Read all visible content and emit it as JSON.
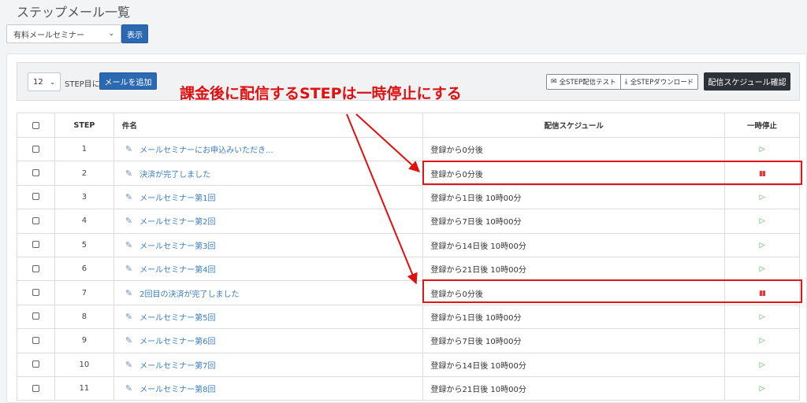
{
  "page": {
    "title": "ステップメール一覧"
  },
  "selector": {
    "value": "有料メールセミナー",
    "show_label": "表示"
  },
  "toolbar": {
    "step_value": "12",
    "step_unit": "STEP目に",
    "add_mail_label": "メールを追加",
    "all_test_label": "全STEP配信テスト",
    "all_download_label": "全STEPダウンロード",
    "schedule_check_label": "配信スケジュール確認"
  },
  "table": {
    "headers": {
      "step": "STEP",
      "subject": "件名",
      "schedule": "配信スケジュール",
      "pause": "一時停止"
    },
    "rows": [
      {
        "step": "1",
        "subject": "メールセミナーにお申込みいただき...",
        "schedule": "登録から0分後",
        "state": "play"
      },
      {
        "step": "2",
        "subject": "決済が完了しました",
        "schedule": "登録から0分後",
        "state": "pause"
      },
      {
        "step": "3",
        "subject": "メールセミナー第1回",
        "schedule": "登録から1日後 10時00分",
        "state": "play"
      },
      {
        "step": "4",
        "subject": "メールセミナー第2回",
        "schedule": "登録から7日後 10時00分",
        "state": "play"
      },
      {
        "step": "5",
        "subject": "メールセミナー第3回",
        "schedule": "登録から14日後 10時00分",
        "state": "play"
      },
      {
        "step": "6",
        "subject": "メールセミナー第4回",
        "schedule": "登録から21日後 10時00分",
        "state": "play"
      },
      {
        "step": "7",
        "subject": "2回目の決済が完了しました",
        "schedule": "登録から0分後",
        "state": "pause"
      },
      {
        "step": "8",
        "subject": "メールセミナー第5回",
        "schedule": "登録から1日後 10時00分",
        "state": "play"
      },
      {
        "step": "9",
        "subject": "メールセミナー第6回",
        "schedule": "登録から7日後 10時00分",
        "state": "play"
      },
      {
        "step": "10",
        "subject": "メールセミナー第7回",
        "schedule": "登録から14日後 10時00分",
        "state": "play"
      },
      {
        "step": "11",
        "subject": "メールセミナー第8回",
        "schedule": "登録から21日後 10時00分",
        "state": "play"
      }
    ]
  },
  "annotation": {
    "callout": "課金後に配信するSTEPは一時停止にする",
    "color": "#e01010"
  },
  "colors": {
    "primary": "#2b69b3",
    "link": "#3a7ebf",
    "play": "#3fae4a",
    "pause": "#e23a3a",
    "dark": "#2d3238"
  },
  "icons": {
    "subject": "pencil-icon",
    "play": "play-icon",
    "pause": "pause-icon",
    "test": "mail-icon",
    "download": "download-icon"
  }
}
